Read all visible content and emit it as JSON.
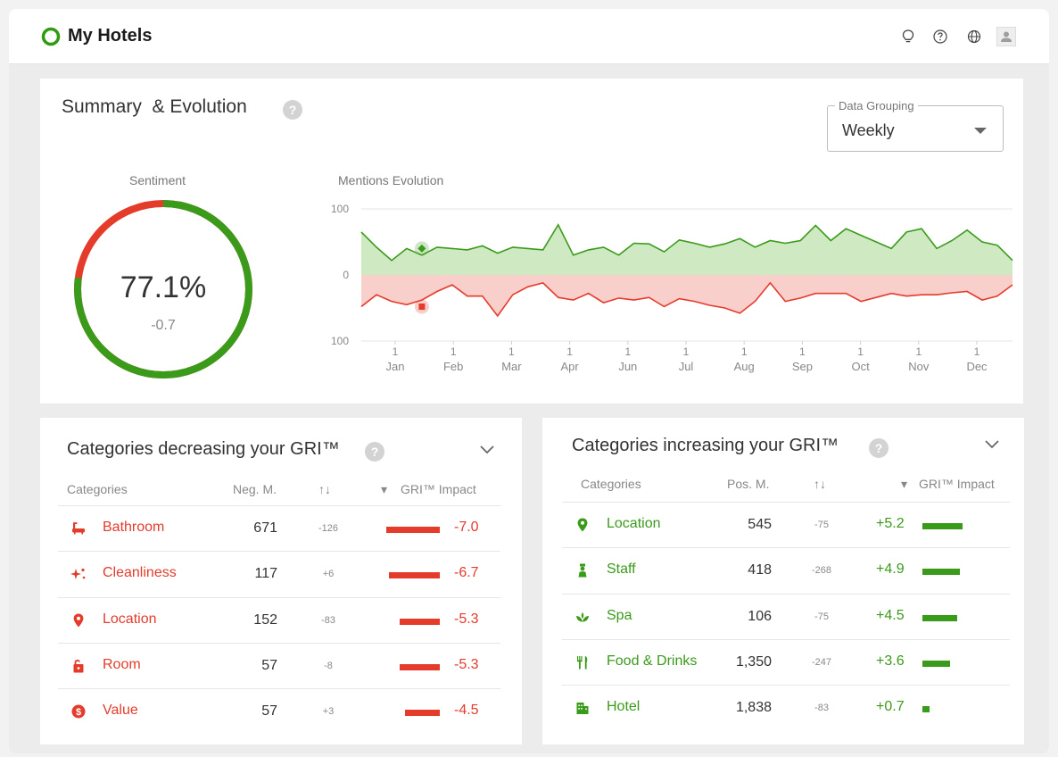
{
  "app": {
    "title": "My Hotels"
  },
  "header_icons": [
    "lightbulb-icon",
    "help-circle-icon",
    "globe-icon",
    "user-avatar-icon"
  ],
  "colors": {
    "positive": "#3a9b1a",
    "negative": "#e43b2b",
    "positive_fill": "#cfe9c2",
    "negative_fill": "#f9cfcb"
  },
  "summary": {
    "title": "Summary  & Evolution",
    "help_label": "?",
    "data_grouping": {
      "label": "Data Grouping",
      "value": "Weekly"
    },
    "sentiment": {
      "label": "Sentiment",
      "value": "77.1%",
      "delta": "-0.7",
      "positive_fraction": 0.771
    }
  },
  "chart_data": {
    "type": "area",
    "title": "Mentions Evolution",
    "x_tick_labels": [
      "Jan",
      "Feb",
      "Mar",
      "Apr",
      "Jun",
      "Jul",
      "Aug",
      "Sep",
      "Oct",
      "Nov",
      "Dec"
    ],
    "x_tick_day": "1",
    "y_tick_labels": [
      "100",
      "0",
      "100"
    ],
    "ylim": [
      -100,
      100
    ],
    "series": [
      {
        "name": "",
        "color": "#3a9b1a",
        "values": [
          65,
          42,
          22,
          40,
          30,
          42,
          40,
          38,
          44,
          33,
          42,
          40,
          38,
          76,
          30,
          38,
          42,
          30,
          48,
          47,
          35,
          53,
          48,
          42,
          47,
          55,
          42,
          52,
          48,
          52,
          75,
          52,
          70,
          60,
          50,
          40,
          65,
          70,
          40,
          52,
          68,
          50,
          45,
          22
        ]
      },
      {
        "name": "",
        "color": "#e43b2b",
        "values": [
          -48,
          -30,
          -40,
          -45,
          -38,
          -25,
          -15,
          -32,
          -32,
          -62,
          -30,
          -18,
          -12,
          -34,
          -38,
          -28,
          -42,
          -35,
          -38,
          -34,
          -48,
          -36,
          -40,
          -46,
          -50,
          -58,
          -40,
          -12,
          -40,
          -35,
          -28,
          -28,
          -28,
          -40,
          -34,
          -28,
          -32,
          -30,
          -30,
          -27,
          -25,
          -38,
          -32,
          -15
        ]
      }
    ],
    "markers": [
      {
        "series": 0,
        "index": 4,
        "value": 40
      },
      {
        "series": 1,
        "index": 4,
        "value": -48
      }
    ],
    "grid": true,
    "legend": "none"
  },
  "decreasing": {
    "title": "Categories decreasing your GRI™",
    "columns": {
      "categories": "Categories",
      "metric": "Neg. M.",
      "sort": "↑↓",
      "impact": "GRI™ Impact",
      "impact_sort": "▾"
    },
    "rows": [
      {
        "icon": "bathtub-icon",
        "name": "Bathroom",
        "metric": "671",
        "delta": "-126",
        "impact": "-7.0",
        "impact_value": -7.0
      },
      {
        "icon": "sparkle-icon",
        "name": "Cleanliness",
        "metric": "117",
        "delta": "+6",
        "impact": "-6.7",
        "impact_value": -6.7
      },
      {
        "icon": "location-pin-icon",
        "name": "Location",
        "metric": "152",
        "delta": "-83",
        "impact": "-5.3",
        "impact_value": -5.3
      },
      {
        "icon": "door-lock-icon",
        "name": "Room",
        "metric": "57",
        "delta": "-8",
        "impact": "-5.3",
        "impact_value": -5.3
      },
      {
        "icon": "dollar-coin-icon",
        "name": "Value",
        "metric": "57",
        "delta": "+3",
        "impact": "-4.5",
        "impact_value": -4.5
      }
    ]
  },
  "increasing": {
    "title": "Categories increasing your GRI™",
    "columns": {
      "categories": "Categories",
      "metric": "Pos. M.",
      "sort": "↑↓",
      "impact": "GRI™ Impact",
      "impact_sort": "▾"
    },
    "rows": [
      {
        "icon": "location-pin-icon",
        "name": "Location",
        "metric": "545",
        "delta": "-75",
        "impact": "+5.2",
        "impact_value": 5.2
      },
      {
        "icon": "staff-icon",
        "name": "Staff",
        "metric": "418",
        "delta": "-268",
        "impact": "+4.9",
        "impact_value": 4.9
      },
      {
        "icon": "spa-lotus-icon",
        "name": "Spa",
        "metric": "106",
        "delta": "-75",
        "impact": "+4.5",
        "impact_value": 4.5
      },
      {
        "icon": "fork-knife-icon",
        "name": "Food & Drinks",
        "metric": "1,350",
        "delta": "-247",
        "impact": "+3.6",
        "impact_value": 3.6
      },
      {
        "icon": "hotel-building-icon",
        "name": "Hotel",
        "metric": "1,838",
        "delta": "-83",
        "impact": "+0.7",
        "impact_value": 0.7
      }
    ]
  }
}
